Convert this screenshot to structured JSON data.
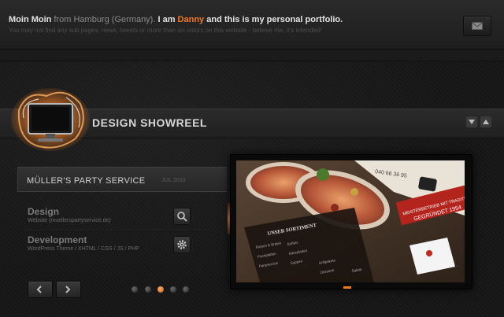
{
  "intro": {
    "part1": "Moin Moin",
    "part2": " from Hamburg (Germany). ",
    "part3": "I am ",
    "name": "Danny",
    "part4": " and this is my personal portfolio.",
    "subline": "You may not find any sub pages, news, tweets or more than six colors on this website - believe me, it's intended!"
  },
  "header": {
    "title": "DESIGN SHOWREEL"
  },
  "project": {
    "title": "MÜLLER'S PARTY SERVICE",
    "date": "JUL 2010",
    "categories": [
      {
        "label": "Design",
        "detail": "Website (muellerspartyservice.de)"
      },
      {
        "label": "Development",
        "detail": "WordPress Theme / XHTML / CSS / JS / PHP"
      }
    ]
  },
  "screenshot": {
    "phone": "040 66 36 95",
    "ribbon1": "MEISTERBETRIEB MIT TRADITION",
    "ribbon2": "GEGRÜNDET 1954",
    "menu_title": "UNSER SORTIMENT",
    "menu_items": [
      "Fleisch & Braten",
      "Buffets",
      "Grillpakete",
      "Fischplatten",
      "Käseplatten",
      "Desserts",
      "Partyservice",
      "Suppen",
      "Salate"
    ]
  },
  "icons": [
    "mail-icon",
    "monitor-logo-icon",
    "arrow-up-icon",
    "arrow-down-icon",
    "magnifier-icon",
    "gear-icon",
    "arrow-left-icon",
    "arrow-right-icon"
  ],
  "accent": "#f07a21",
  "slider": {
    "count": 5,
    "active": 3
  }
}
